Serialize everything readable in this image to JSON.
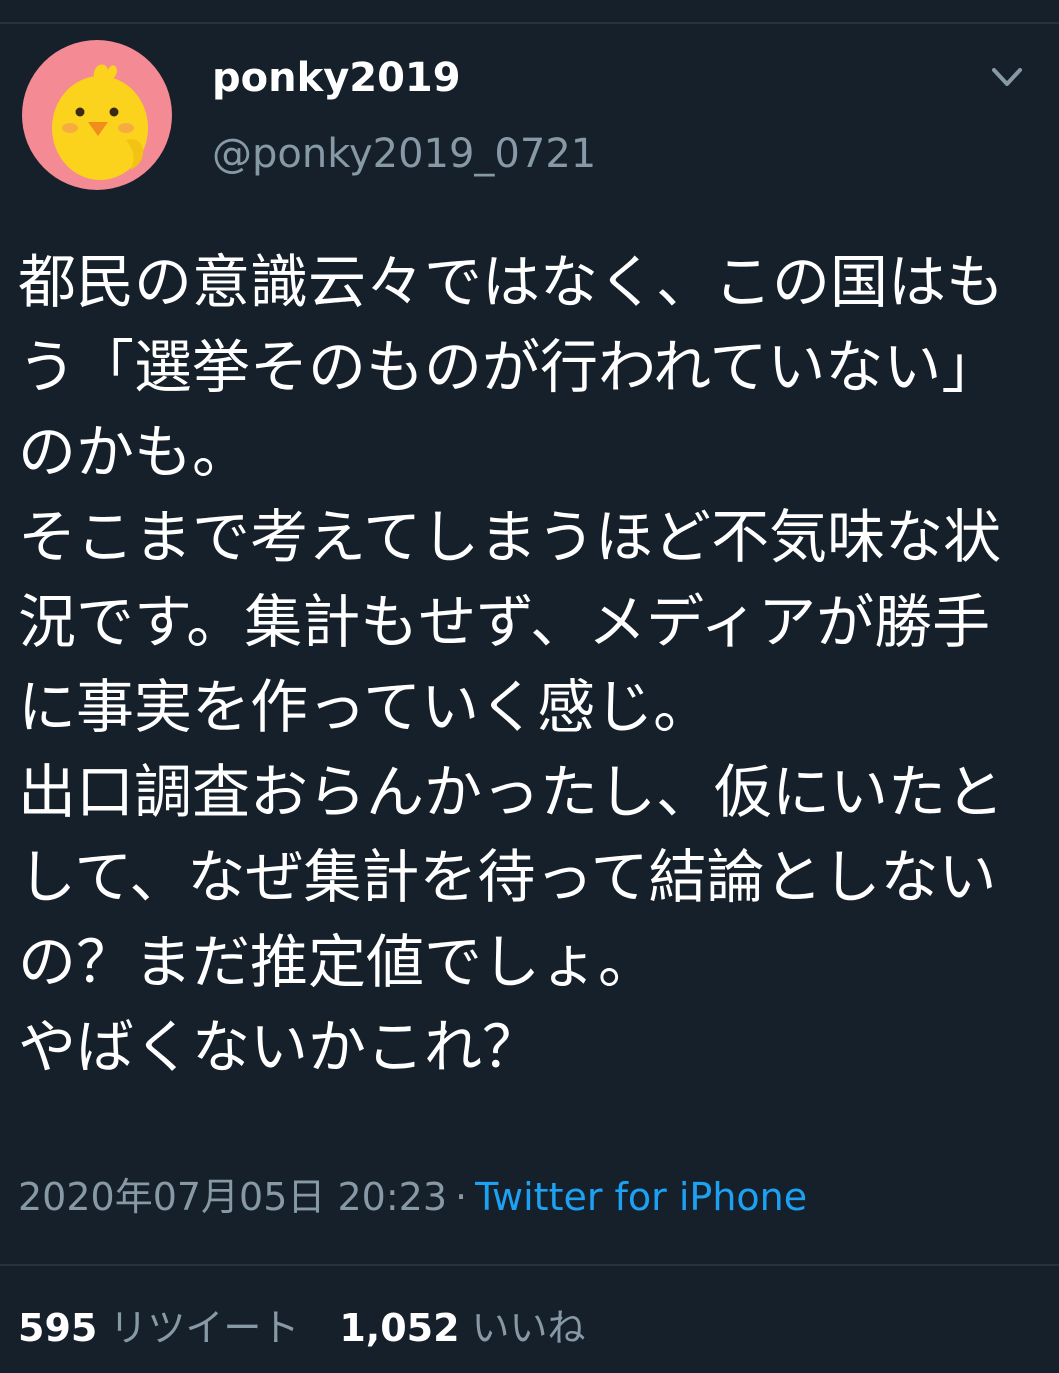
{
  "tweet": {
    "author": {
      "display_name": "ponky2019",
      "handle": "@ponky2019_0721",
      "avatar_icon": "yellow-chick-avatar",
      "avatar_bg_color": "#f48a93"
    },
    "text": "都民の意識云々ではなく、この国はもう「選挙そのものが行われていない」のかも。\nそこまで考えてしまうほど不気味な状況です。集計もせず、メディアが勝手に事実を作っていく感じ。\n出口調査おらんかったし、仮にいたとして、なぜ集計を待って結論としないの？まだ推定値でしょ。\nやばくないかこれ？",
    "timestamp": "2020年07月05日 20:23",
    "separator": "·",
    "source": "Twitter for iPhone",
    "stats": {
      "retweets_count": "595",
      "retweets_label": "リツイート",
      "likes_count": "1,052",
      "likes_label": "いいね"
    },
    "menu_icon": "chevron-down-icon"
  },
  "colors": {
    "background": "#15202b",
    "text_primary": "#ffffff",
    "text_secondary": "#8899a6",
    "link": "#1da1f2",
    "divider": "#253341"
  }
}
